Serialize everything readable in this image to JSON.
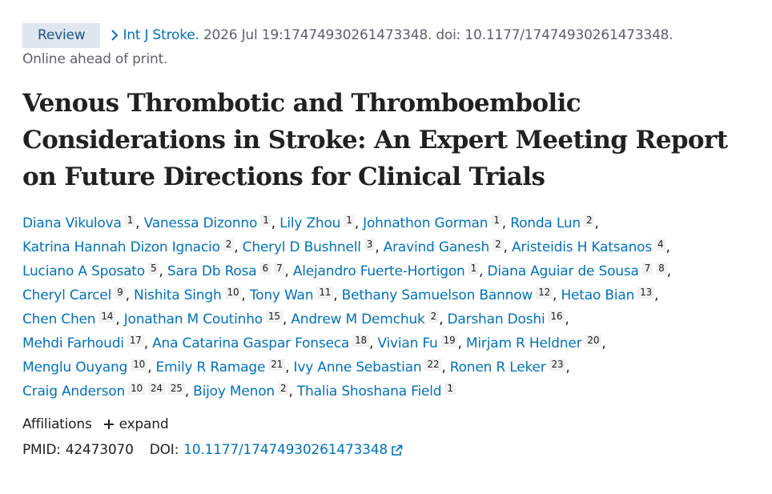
{
  "header": {
    "badge": "Review",
    "journal": "Int J Stroke.",
    "citation": "2026 Jul 19:17474930261473348. doi: 10.1177/17474930261473348.",
    "status": "Online ahead of print."
  },
  "article": {
    "title": "Venous Thrombotic and Thromboembolic Considerations in Stroke: An Expert Meeting Report on Future Directions for Clinical Trials"
  },
  "authors": [
    {
      "name": "Diana Vikulova",
      "affil": [
        "1"
      ]
    },
    {
      "name": "Vanessa Dizonno",
      "affil": [
        "1"
      ]
    },
    {
      "name": "Lily Zhou",
      "affil": [
        "1"
      ]
    },
    {
      "name": "Johnathon Gorman",
      "affil": [
        "1"
      ]
    },
    {
      "name": "Ronda Lun",
      "affil": [
        "2"
      ]
    },
    {
      "name": "Katrina Hannah Dizon Ignacio",
      "affil": [
        "2"
      ]
    },
    {
      "name": "Cheryl D Bushnell",
      "affil": [
        "3"
      ]
    },
    {
      "name": "Aravind Ganesh",
      "affil": [
        "2"
      ]
    },
    {
      "name": "Aristeidis H Katsanos",
      "affil": [
        "4"
      ]
    },
    {
      "name": "Luciano A Sposato",
      "affil": [
        "5"
      ]
    },
    {
      "name": "Sara Db Rosa",
      "affil": [
        "6",
        "7"
      ]
    },
    {
      "name": "Alejandro Fuerte-Hortigon",
      "affil": [
        "1"
      ]
    },
    {
      "name": "Diana Aguiar de Sousa",
      "affil": [
        "7",
        "8"
      ]
    },
    {
      "name": "Cheryl Carcel",
      "affil": [
        "9"
      ]
    },
    {
      "name": "Nishita Singh",
      "affil": [
        "10"
      ]
    },
    {
      "name": "Tony Wan",
      "affil": [
        "11"
      ]
    },
    {
      "name": "Bethany Samuelson Bannow",
      "affil": [
        "12"
      ]
    },
    {
      "name": "Hetao Bian",
      "affil": [
        "13"
      ]
    },
    {
      "name": "Chen Chen",
      "affil": [
        "14"
      ]
    },
    {
      "name": "Jonathan M Coutinho",
      "affil": [
        "15"
      ]
    },
    {
      "name": "Andrew M Demchuk",
      "affil": [
        "2"
      ]
    },
    {
      "name": "Darshan Doshi",
      "affil": [
        "16"
      ]
    },
    {
      "name": "Mehdi Farhoudi",
      "affil": [
        "17"
      ]
    },
    {
      "name": "Ana Catarina Gaspar Fonseca",
      "affil": [
        "18"
      ]
    },
    {
      "name": "Vivian Fu",
      "affil": [
        "19"
      ]
    },
    {
      "name": "Mirjam R Heldner",
      "affil": [
        "20"
      ]
    },
    {
      "name": "Menglu Ouyang",
      "affil": [
        "10"
      ]
    },
    {
      "name": "Emily R Ramage",
      "affil": [
        "21"
      ]
    },
    {
      "name": "Ivy Anne Sebastian",
      "affil": [
        "22"
      ]
    },
    {
      "name": "Ronen R Leker",
      "affil": [
        "23"
      ]
    },
    {
      "name": "Craig Anderson",
      "affil": [
        "10",
        "24",
        "25"
      ]
    },
    {
      "name": "Bijoy Menon",
      "affil": [
        "2"
      ]
    },
    {
      "name": "Thalia Shoshana Field",
      "affil": [
        "1"
      ]
    }
  ],
  "author_lines": [
    5,
    4,
    4,
    5,
    4,
    4,
    4,
    3
  ],
  "affiliations": {
    "label": "Affiliations",
    "expand": "expand"
  },
  "identifiers": {
    "pmid_label": "PMID:",
    "pmid": "42473070",
    "doi_label": "DOI:",
    "doi": "10.1177/17474930261473348"
  },
  "icons": {
    "chevron": "chevron-right-icon",
    "plus": "plus-icon",
    "external": "external-link-icon"
  },
  "colors": {
    "link": "#0071bc",
    "badge_bg": "#dfe6f0",
    "badge_text": "#20558a",
    "muted": "#5b616b"
  }
}
